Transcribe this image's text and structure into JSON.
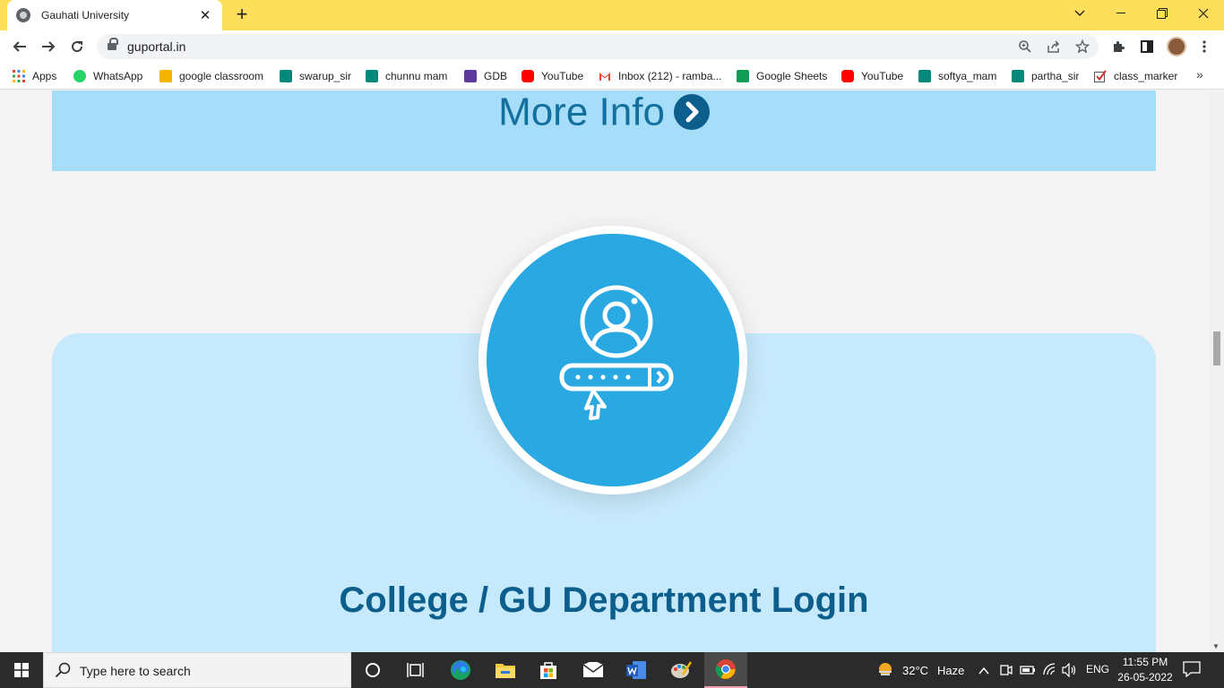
{
  "browser": {
    "tab_title": "Gauhati University",
    "url": "guportal.in",
    "bookmarks": [
      {
        "label": "Apps",
        "color": "#ea4335"
      },
      {
        "label": "WhatsApp",
        "color": "#25d366"
      },
      {
        "label": "google classroom",
        "color": "#f4b400"
      },
      {
        "label": "swarup_sir",
        "color": "#00897b"
      },
      {
        "label": "chunnu mam",
        "color": "#00897b"
      },
      {
        "label": "GDB",
        "color": "#5c3a9e"
      },
      {
        "label": "YouTube",
        "color": "#ff0000"
      },
      {
        "label": "Inbox (212) - ramba...",
        "color": "#ea4335"
      },
      {
        "label": "Google Sheets",
        "color": "#0f9d58"
      },
      {
        "label": "YouTube",
        "color": "#ff0000"
      },
      {
        "label": "softya_mam",
        "color": "#00897b"
      },
      {
        "label": "partha_sir",
        "color": "#00897b"
      },
      {
        "label": "class_marker",
        "color": "#d32f2f"
      }
    ],
    "overflow_icon": "double-chevron-icon"
  },
  "page": {
    "more_info_label": "More Info",
    "login_title": "College / GU Department Login",
    "colors": {
      "info_band": "#a6ddf8",
      "login_card": "#c6e9fb",
      "login_circle": "#29a8e1",
      "heading": "#0c5e8c"
    }
  },
  "taskbar": {
    "search_placeholder": "Type here to search",
    "weather_temp": "32°C",
    "weather_text": "Haze",
    "language": "ENG",
    "time": "11:55 PM",
    "date": "26-05-2022"
  }
}
